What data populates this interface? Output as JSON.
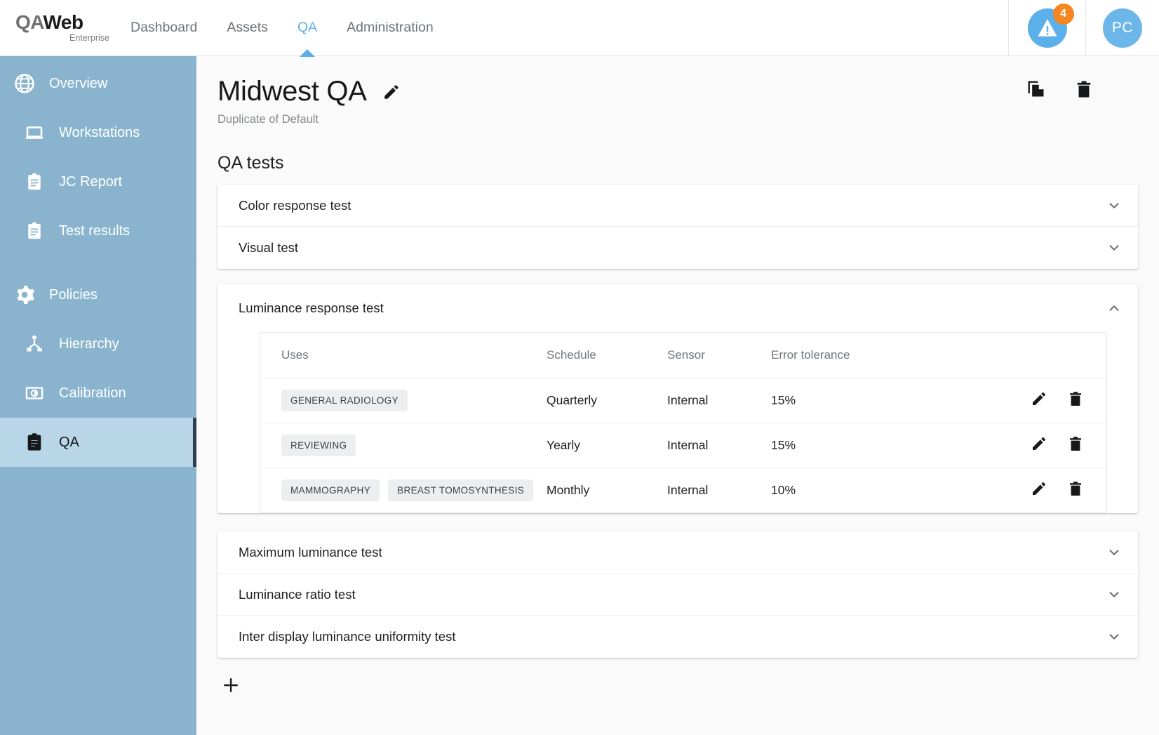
{
  "app": {
    "logo_part1": "QA",
    "logo_part2": "Web",
    "logo_sub": "Enterprise"
  },
  "topnav": {
    "items": [
      {
        "label": "Dashboard",
        "active": false
      },
      {
        "label": "Assets",
        "active": false
      },
      {
        "label": "QA",
        "active": true
      },
      {
        "label": "Administration",
        "active": false
      }
    ],
    "notification_count": "4",
    "notification_icon": "warning-triangle-icon",
    "avatar_initials": "PC",
    "accent_color": "#5cb0ea",
    "badge_color": "#f5861f"
  },
  "sidebar": {
    "background_color": "#8ab4ce",
    "selected_color": "#b8d6e8",
    "items": [
      {
        "label": "Overview",
        "icon": "globe-icon",
        "level": 0,
        "selected": false
      },
      {
        "label": "Workstations",
        "icon": "laptop-icon",
        "level": 1,
        "selected": false
      },
      {
        "label": "JC Report",
        "icon": "clipboard-icon",
        "level": 1,
        "selected": false
      },
      {
        "label": "Test results",
        "icon": "clipboard-icon",
        "level": 1,
        "selected": false
      },
      {
        "label": "Policies",
        "icon": "gear-icon",
        "level": 0,
        "selected": false
      },
      {
        "label": "Hierarchy",
        "icon": "hierarchy-icon",
        "level": 1,
        "selected": false
      },
      {
        "label": "Calibration",
        "icon": "calibration-icon",
        "level": 1,
        "selected": false
      },
      {
        "label": "QA",
        "icon": "clipboard-icon",
        "level": 1,
        "selected": true
      }
    ]
  },
  "page": {
    "title": "Midwest QA",
    "subtitle": "Duplicate of Default",
    "edit_icon": "pencil-icon",
    "duplicate_icon": "copy-icon",
    "delete_icon": "trash-icon",
    "section_title": "QA tests"
  },
  "tests": {
    "group1": [
      {
        "name": "Color response test",
        "expanded": false,
        "chevron": "chevron-down-icon"
      },
      {
        "name": "Visual test",
        "expanded": false,
        "chevron": "chevron-down-icon"
      }
    ],
    "expanded_test": {
      "name": "Luminance response test",
      "chevron": "chevron-up-icon",
      "table": {
        "headers": [
          "Uses",
          "Schedule",
          "Sensor",
          "Error tolerance",
          ""
        ],
        "rows": [
          {
            "uses": [
              "GENERAL RADIOLOGY"
            ],
            "schedule": "Quarterly",
            "sensor": "Internal",
            "tolerance": "15%",
            "edit_icon": "pencil-icon",
            "delete_icon": "trash-icon"
          },
          {
            "uses": [
              "REVIEWING"
            ],
            "schedule": "Yearly",
            "sensor": "Internal",
            "tolerance": "15%",
            "edit_icon": "pencil-icon",
            "delete_icon": "trash-icon"
          },
          {
            "uses": [
              "MAMMOGRAPHY",
              "BREAST TOMOSYNTHESIS"
            ],
            "schedule": "Monthly",
            "sensor": "Internal",
            "tolerance": "10%",
            "edit_icon": "pencil-icon",
            "delete_icon": "trash-icon"
          }
        ]
      }
    },
    "group2": [
      {
        "name": "Maximum luminance test",
        "expanded": false,
        "chevron": "chevron-down-icon"
      },
      {
        "name": "Luminance ratio test",
        "expanded": false,
        "chevron": "chevron-down-icon"
      },
      {
        "name": "Inter display luminance uniformity test",
        "expanded": false,
        "chevron": "chevron-down-icon"
      }
    ],
    "add_label": "+",
    "add_icon": "plus-icon"
  }
}
